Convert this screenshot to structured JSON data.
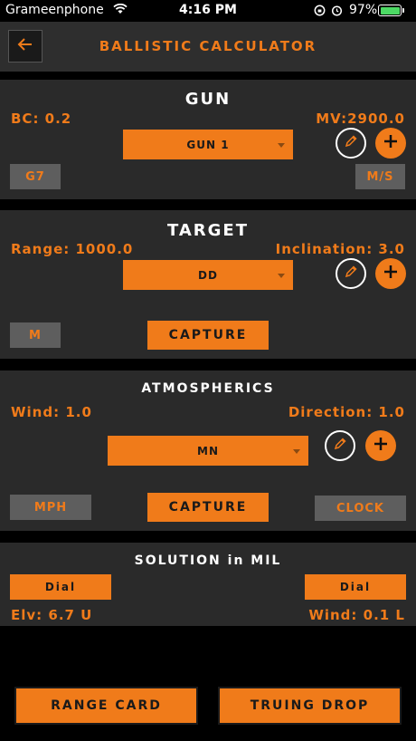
{
  "status_bar": {
    "carrier": "Grameenphone",
    "time": "4:16 PM",
    "battery": "97%"
  },
  "header": {
    "title": "BALLISTIC CALCULATOR"
  },
  "gun": {
    "title": "GUN",
    "bc_label": "BC: 0.2",
    "mv_label": "MV:2900.0",
    "selected": "GUN 1",
    "drag_model": "G7",
    "velocity_unit": "M/S"
  },
  "target": {
    "title": "TARGET",
    "range_label": "Range: 1000.0",
    "inclination_label": "Inclination: 3.0",
    "selected": "DD",
    "unit": "M",
    "capture_label": "CAPTURE"
  },
  "atmospherics": {
    "title": "ATMOSPHERICS",
    "wind_label": "Wind: 1.0",
    "direction_label": "Direction: 1.0",
    "selected": "MN",
    "unit": "MPH",
    "capture_label": "CAPTURE",
    "clock_label": "CLOCK"
  },
  "solution": {
    "title": "SOLUTION in MIL",
    "dial_left": "Dial",
    "dial_right": "Dial",
    "elevation_label": "Elv: 6.7 U",
    "wind_label": "Wind: 0.1 L"
  },
  "footer": {
    "range_card": "RANGE CARD",
    "truing_drop": "TRUING DROP"
  },
  "colors": {
    "accent": "#f07b1a",
    "panel": "#2a2a2a",
    "background": "#000000"
  }
}
